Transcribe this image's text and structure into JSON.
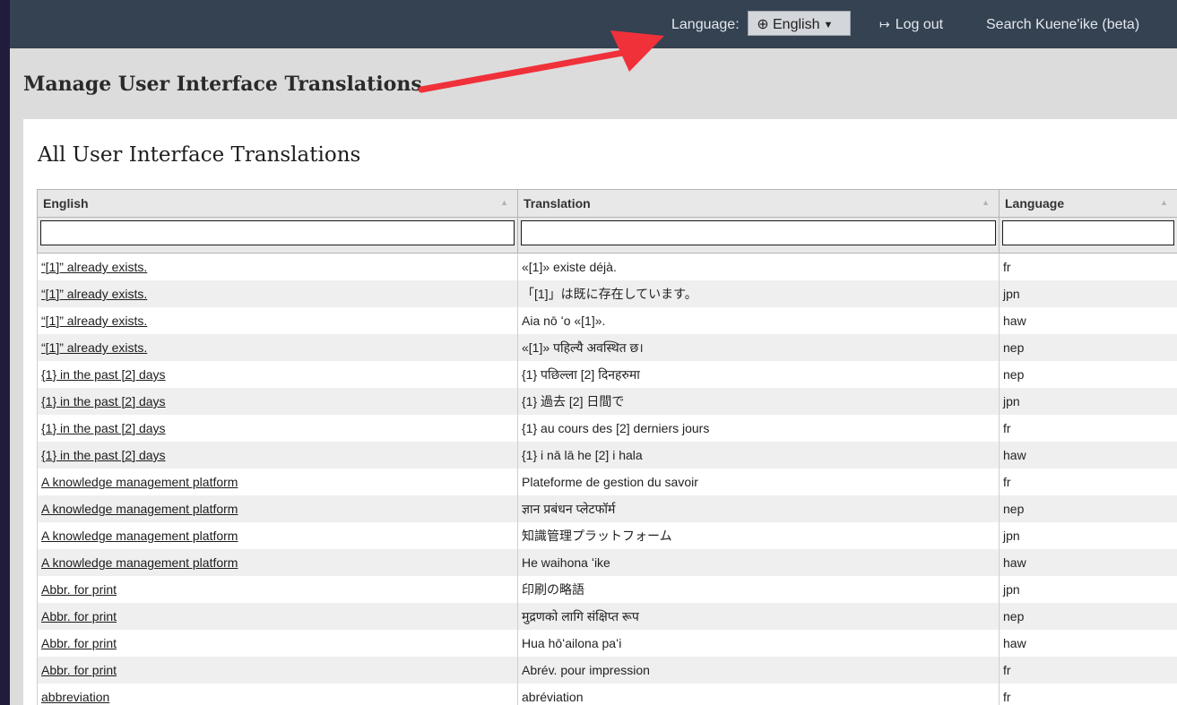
{
  "topbar": {
    "language_label": "Language:",
    "language_button": "English",
    "globe_icon": "globe-icon",
    "logout_label": "Log out",
    "logout_icon": "sign-out-icon",
    "search_label": "Search Kuene'ike (beta)"
  },
  "page_title": "Manage User Interface Translations",
  "panel_title": "All User Interface Translations",
  "table": {
    "columns": [
      "English",
      "Translation",
      "Language"
    ],
    "rows": [
      [
        "“[1]” already exists.",
        "«[1]» existe déjà.",
        "fr"
      ],
      [
        "“[1]” already exists.",
        "「[1]」は既に存在しています。",
        "jpn"
      ],
      [
        "“[1]” already exists.",
        "Aia nō ʻo «[1]».",
        "haw"
      ],
      [
        "“[1]” already exists.",
        "«[1]» पहिल्यै अवस्थित छ।",
        "nep"
      ],
      [
        "{1} in the past [2] days",
        "{1} पछिल्ला [2] दिनहरुमा",
        "nep"
      ],
      [
        "{1} in the past [2] days",
        "{1} 過去 [2] 日間で",
        "jpn"
      ],
      [
        "{1} in the past [2] days",
        "{1} au cours des [2] derniers jours",
        "fr"
      ],
      [
        "{1} in the past [2] days",
        "{1} i nā lā he [2] i hala",
        "haw"
      ],
      [
        "A knowledge management platform",
        "Plateforme de gestion du savoir",
        "fr"
      ],
      [
        "A knowledge management platform",
        "ज्ञान प्रबंधन प्लेटफॉर्म",
        "nep"
      ],
      [
        "A knowledge management platform",
        "知識管理プラットフォーム",
        "jpn"
      ],
      [
        "A knowledge management platform",
        "He waihona ʻike",
        "haw"
      ],
      [
        "Abbr. for print",
        "印刷の略語",
        "jpn"
      ],
      [
        "Abbr. for print",
        "मुद्रणको लागि संक्षिप्त रूप",
        "nep"
      ],
      [
        "Abbr. for print",
        "Hua hōʻailona paʻi",
        "haw"
      ],
      [
        "Abbr. for print",
        "Abrév. pour impression",
        "fr"
      ],
      [
        "abbreviation",
        "abréviation",
        "fr"
      ]
    ]
  },
  "annotation_color": "#f0313a"
}
